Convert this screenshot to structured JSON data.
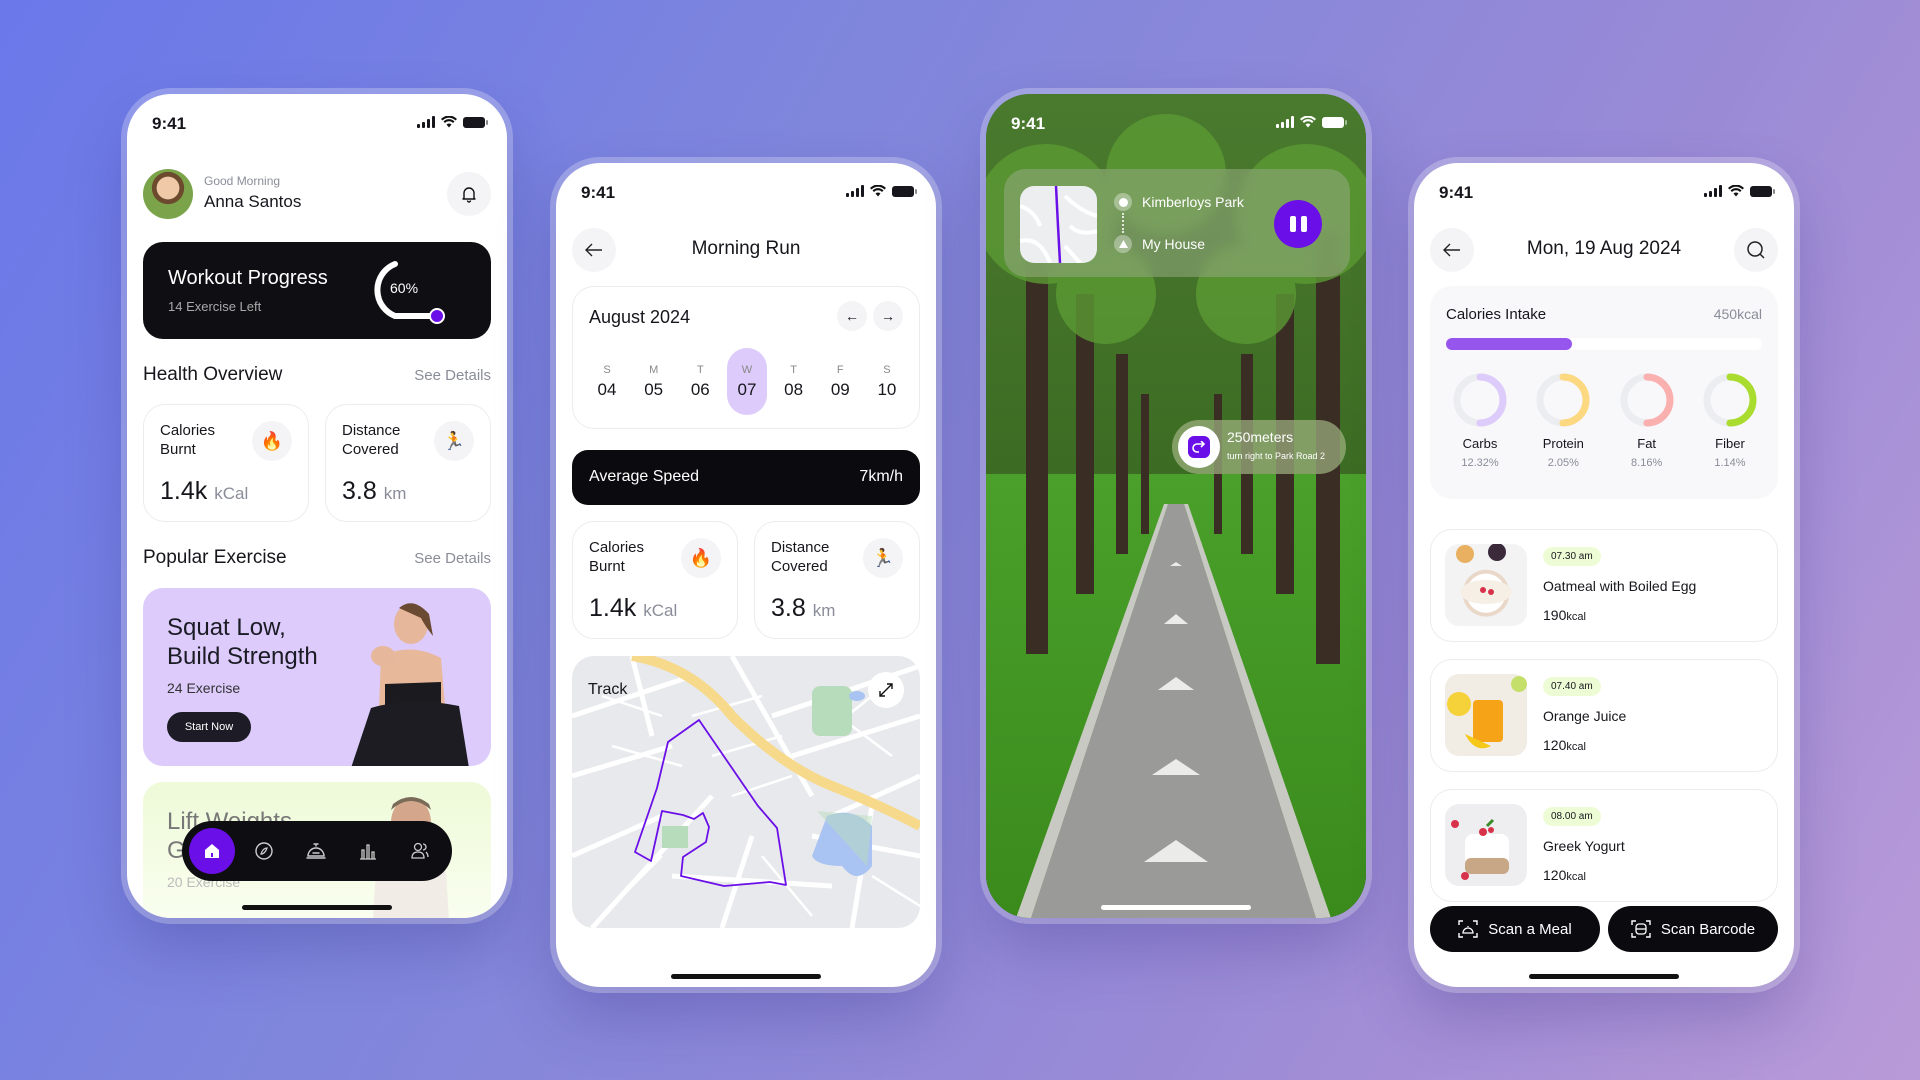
{
  "status_time": "9:41",
  "screen1": {
    "greeting": "Good Morning",
    "user_name": "Anna Santos",
    "workout": {
      "title": "Workout Progress",
      "subtitle": "14 Exercise Left",
      "progress_label": "60%",
      "progress": 0.6
    },
    "health_overview": {
      "title": "Health Overview",
      "see_details": "See Details"
    },
    "stats": [
      {
        "label": "Calories Burnt",
        "value": "1.4k",
        "unit": "kCal",
        "icon": "fire-icon"
      },
      {
        "label": "Distance Covered",
        "value": "3.8",
        "unit": "km",
        "icon": "runner-icon"
      }
    ],
    "popular": {
      "title": "Popular Exercise",
      "see_details": "See Details"
    },
    "exercises": [
      {
        "title": "Squat Low, Build Strength",
        "count": "24 Exercise",
        "button": "Start Now"
      },
      {
        "title": "Lift Weights, G...",
        "count": "20 Exercise"
      }
    ],
    "tabbar": [
      "home-icon",
      "compass-icon",
      "diet-icon",
      "chart-icon",
      "community-icon"
    ]
  },
  "screen2": {
    "title": "Morning Run",
    "calendar": {
      "month": "August 2024",
      "days": [
        {
          "dow": "S",
          "date": "04"
        },
        {
          "dow": "M",
          "date": "05"
        },
        {
          "dow": "T",
          "date": "06"
        },
        {
          "dow": "W",
          "date": "07",
          "selected": true
        },
        {
          "dow": "T",
          "date": "08"
        },
        {
          "dow": "F",
          "date": "09"
        },
        {
          "dow": "S",
          "date": "10"
        }
      ]
    },
    "average_speed": {
      "label": "Average Speed",
      "value": "7km/h"
    },
    "stats": [
      {
        "label": "Calories Burnt",
        "value": "1.4k",
        "unit": "kCal",
        "icon": "fire-icon"
      },
      {
        "label": "Distance Covered",
        "value": "3.8",
        "unit": "km",
        "icon": "runner-icon"
      }
    ],
    "track_label": "Track"
  },
  "screen3": {
    "route_from": "Kimberloys Park",
    "route_to": "My House",
    "instruction": {
      "distance": "250meters",
      "text": "turn right to Park Road 2"
    }
  },
  "screen4": {
    "title": "Mon, 19 Aug 2024",
    "intake": {
      "title": "Calories Intake",
      "value": "450kcal",
      "progress": 0.4
    },
    "macros": [
      {
        "name": "Carbs",
        "pct": "12.32%",
        "color": "#dccbfb",
        "progress": 0.5
      },
      {
        "name": "Protein",
        "pct": "2.05%",
        "color": "#fcd980",
        "progress": 0.5
      },
      {
        "name": "Fat",
        "pct": "8.16%",
        "color": "#fbb0b0",
        "progress": 0.5
      },
      {
        "name": "Fiber",
        "pct": "1.14%",
        "color": "#a9dc2e",
        "progress": 0.5
      }
    ],
    "meals": [
      {
        "time": "07.30 am",
        "name": "Oatmeal with Boiled Egg",
        "kcal": "190",
        "unit": "kcal"
      },
      {
        "time": "07.40 am",
        "name": "Orange Juice",
        "kcal": "120",
        "unit": "kcal"
      },
      {
        "time": "08.00 am",
        "name": "Greek Yogurt",
        "kcal": "120",
        "unit": "kcal"
      }
    ],
    "scan_meal": "Scan a Meal",
    "scan_barcode": "Scan Barcode"
  },
  "colors": {
    "accent": "#6b0fe8",
    "lavender": "#dccbfb",
    "dark": "#0f0f13"
  }
}
